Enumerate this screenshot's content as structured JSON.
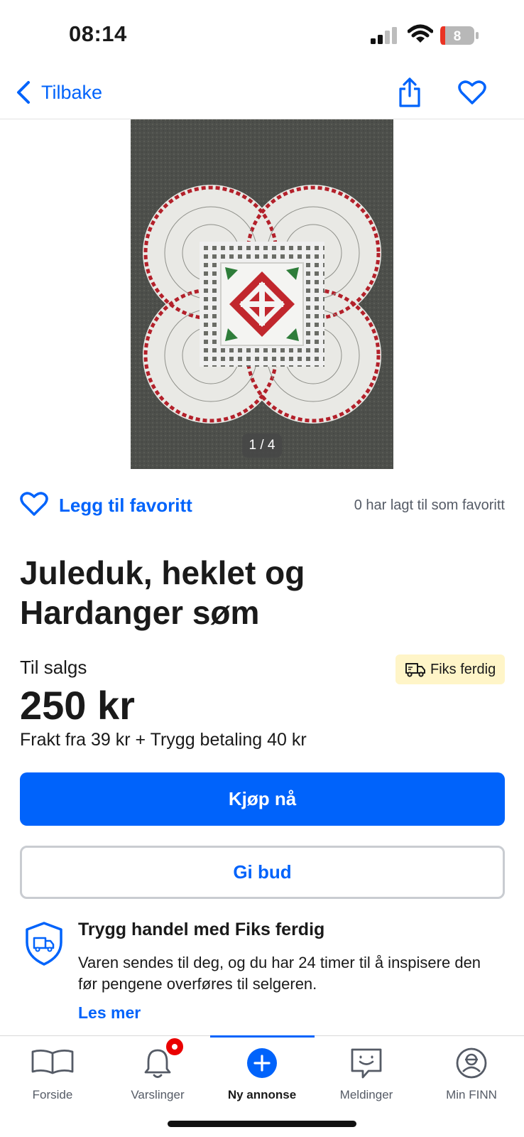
{
  "status_bar": {
    "time": "08:14",
    "battery_level": "8"
  },
  "nav": {
    "back_label": "Tilbake"
  },
  "gallery": {
    "counter": "1 / 4"
  },
  "favorite": {
    "label": "Legg til favoritt",
    "count_text": "0 har lagt til som favoritt"
  },
  "listing": {
    "title": "Juleduk, heklet og Hardanger søm",
    "sale_label": "Til salgs",
    "badge": "Fiks ferdig",
    "price": "250 kr",
    "shipping": "Frakt fra 39 kr + Trygg betaling 40 kr"
  },
  "actions": {
    "buy": "Kjøp nå",
    "bid": "Gi bud"
  },
  "trygg": {
    "title": "Trygg handel med Fiks ferdig",
    "text": "Varen sendes til deg, og du har 24 timer til å inspisere den før pengene overføres til selgeren.",
    "link": "Les mer"
  },
  "tabs": [
    {
      "label": "Forside",
      "icon": "book-icon"
    },
    {
      "label": "Varslinger",
      "icon": "bell-icon"
    },
    {
      "label": "Ny annonse",
      "icon": "plus-circle-icon"
    },
    {
      "label": "Meldinger",
      "icon": "chat-icon"
    },
    {
      "label": "Min FINN",
      "icon": "profile-icon"
    }
  ],
  "colors": {
    "accent": "#0063fb",
    "badge_bg": "#fff5c8",
    "notification": "#ea0000"
  }
}
